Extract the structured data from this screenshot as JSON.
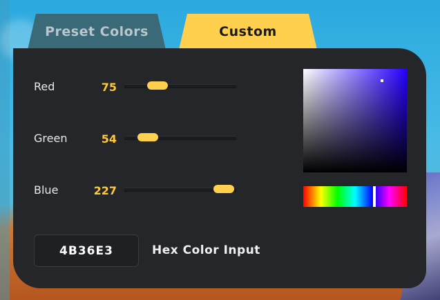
{
  "tabs": {
    "preset_label": "Preset Colors",
    "custom_label": "Custom"
  },
  "sliders": [
    {
      "label": "Red",
      "value": "75",
      "fraction": 0.294
    },
    {
      "label": "Green",
      "value": "54",
      "fraction": 0.212
    },
    {
      "label": "Blue",
      "value": "227",
      "fraction": 0.89
    }
  ],
  "picker": {
    "hue_color": "#2400ff",
    "saturation": 0.76,
    "brightness": 0.89,
    "hue_fraction": 0.685
  },
  "hex": {
    "value": "4B36E3",
    "label": "Hex Color Input"
  },
  "colors": {
    "accent": "#ffd04d",
    "value_text": "#ffc93a",
    "panel": "#24262a",
    "inactive_tab": "#3a6a78"
  }
}
